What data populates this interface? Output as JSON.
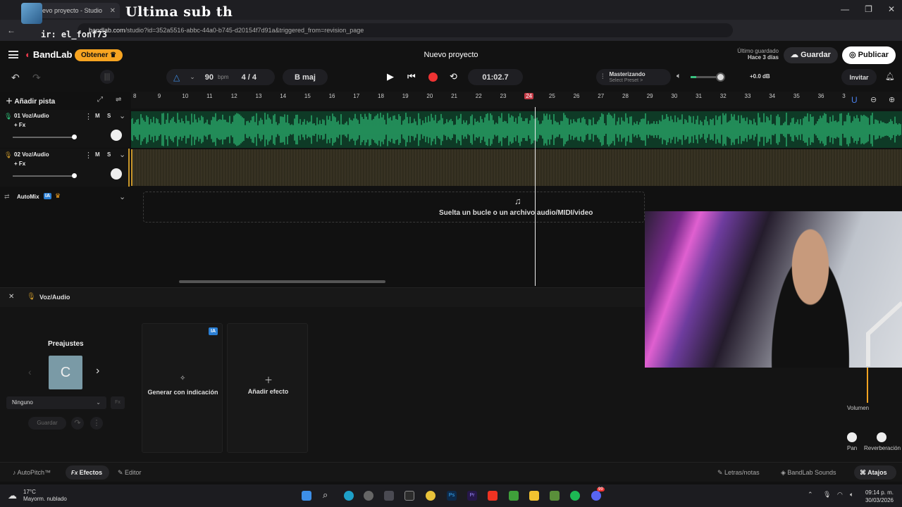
{
  "browser": {
    "tab_title": "evo proyecto - Studio",
    "overlay_title": "Ultima sub  th",
    "overlay_user": "ir: el_fonf73",
    "url_domain": "bandlab.com",
    "url_path": "/studio?id=352a5516-abbc-44a0-b745-d20154f7d91a&triggered_from=revision_page"
  },
  "app": {
    "brand": "BandLab",
    "obtener": "Obtener ♛",
    "project_title": "Nuevo proyecto",
    "saved_label": "Último guardado",
    "saved_time": "Hace 3 días",
    "save_button": "Guardar",
    "publish_button": "Publicar"
  },
  "transport": {
    "bpm_value": "90",
    "bpm_unit": "bpm",
    "time_sig": "4 / 4",
    "key": "B maj",
    "time": "01:02.7",
    "mastering_title": "Masterizando",
    "mastering_preset": "Select Preset >",
    "db": "+0.0 dB",
    "invite": "Invitar"
  },
  "toolbar": {
    "add_track": "Añadir pista"
  },
  "ruler": [
    "8",
    "9",
    "10",
    "11",
    "12",
    "13",
    "14",
    "15",
    "16",
    "17",
    "18",
    "19",
    "20",
    "21",
    "22",
    "23",
    "24",
    "25",
    "26",
    "27",
    "28",
    "29",
    "30",
    "31",
    "32",
    "33",
    "34",
    "35",
    "36",
    "3"
  ],
  "ruler_active": "24",
  "tracks": [
    {
      "name": "01  Voz/Audio",
      "fx": "+ Fx",
      "m": "M",
      "s": "S",
      "color": "#2fc27a"
    },
    {
      "name": "02  Voz/Audio",
      "fx": "+ Fx",
      "m": "M",
      "s": "S",
      "color": "#c8962a"
    }
  ],
  "automix": {
    "label": "AutoMix",
    "badge": "IA"
  },
  "dropzone": {
    "text": "Suelta un bucle o un archivo audio/MIDI/video"
  },
  "panel": {
    "title": "Voz/Audio",
    "presets_title": "Preajustes",
    "preset_letter": "C",
    "preset_select": "Ninguno",
    "save_preset": "Guardar",
    "generate": "Generar con indicación",
    "generate_badge": "IA",
    "add_effect": "Añadir efecto",
    "volume": "Volumen",
    "pan": "Pan",
    "reverb": "Reverberación"
  },
  "bottom_tabs": {
    "autopitch": "AutoPitch™",
    "effects": "Efectos",
    "editor": "Editor",
    "lyrics": "Letras/notas",
    "sounds": "BandLab Sounds",
    "shortcuts": "Atajos"
  },
  "taskbar": {
    "temp": "17°C",
    "weather": "Mayorm. nublado",
    "time": "09:14 p. m.",
    "date": "30/03/2026",
    "badge": "99"
  }
}
